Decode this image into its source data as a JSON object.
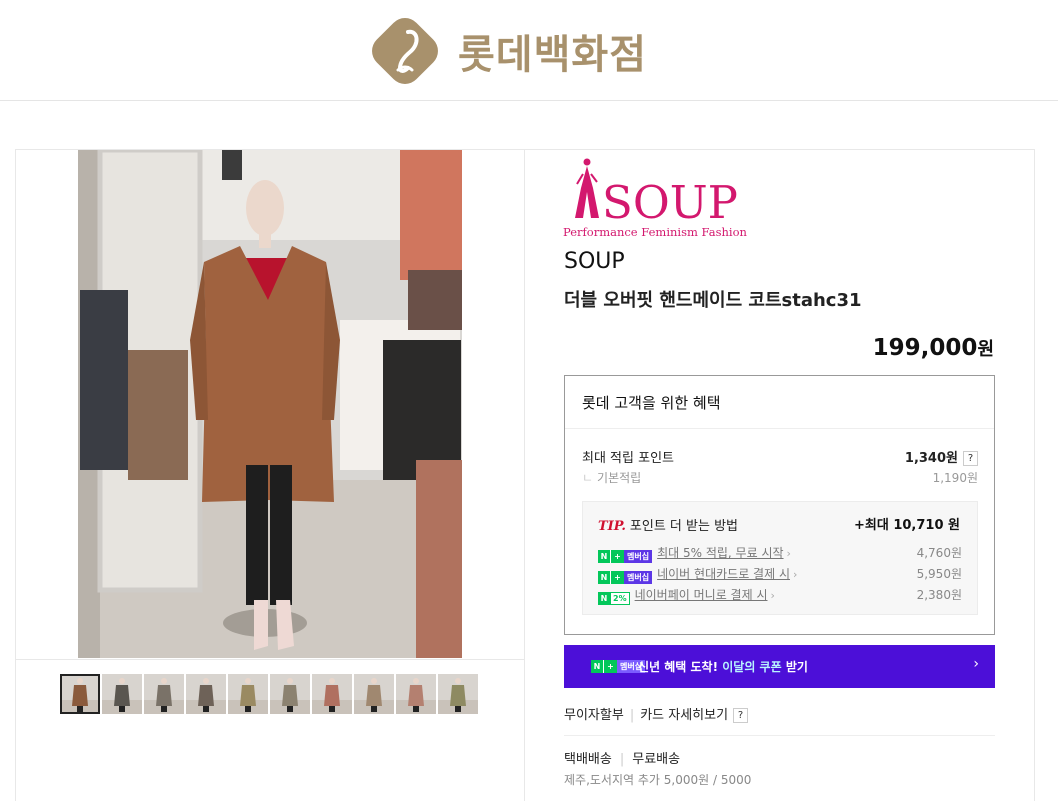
{
  "header": {
    "store_name": "롯데백화점",
    "logo_icon": "lotte-department-store-logo"
  },
  "gallery": {
    "main_image": "mannequin-camel-double-coat-in-store",
    "thumbnails": [
      {
        "icon": "thumb-1",
        "active": true
      },
      {
        "icon": "thumb-2"
      },
      {
        "icon": "thumb-3"
      },
      {
        "icon": "thumb-4"
      },
      {
        "icon": "thumb-5"
      },
      {
        "icon": "thumb-6"
      },
      {
        "icon": "thumb-7"
      },
      {
        "icon": "thumb-8"
      },
      {
        "icon": "thumb-9"
      },
      {
        "icon": "thumb-10"
      }
    ]
  },
  "product": {
    "brand_logo_text": "SOUP",
    "brand_logo_tagline": "Performance Feminism Fashion",
    "brand": "SOUP",
    "name": "더블 오버핏 핸드메이드 코트stahc31",
    "price": "199,000",
    "currency": "원"
  },
  "benefits": {
    "title": "롯데 고객을 위한 혜택",
    "max_points_label": "최대 적립 포인트",
    "max_points_value": "1,340원",
    "help_label": "?",
    "base_points_label": "기본적립",
    "base_points_value": "1,190원",
    "tip": {
      "tip_label": "TIP.",
      "heading": "포인트 더 받는 방법",
      "max_value": "+최대 10,710 원",
      "rows": [
        {
          "label": "최대 5% 적립, 무료 시작",
          "value": "4,760원",
          "badge": "membership"
        },
        {
          "label": "네이버 현대카드로 결제 시",
          "value": "5,950원",
          "badge": "membership"
        },
        {
          "label": "네이버페이 머니로 결제 시",
          "value": "2,380원",
          "badge": "2%"
        }
      ]
    }
  },
  "badges": {
    "n": "N",
    "plus": "+",
    "membership": "멤버십",
    "pct": "2%"
  },
  "promo": {
    "text_main": "신년 혜택 도착! ",
    "text_highlight": "이달의 쿠폰",
    "text_end": " 받기",
    "chevron": "›"
  },
  "installment": {
    "label": "무이자할부",
    "detail": "카드 자세히보기",
    "help": "?"
  },
  "delivery": {
    "type": "택배배송",
    "fee": "무료배송",
    "extra": "제주,도서지역 추가 5,000원 / 5000"
  },
  "colors": {
    "brand_gold": "#a8916c",
    "soup_pink": "#d3186e",
    "naver_green": "#03c75a",
    "promo_purple": "#4c0fd8",
    "tip_red": "#d0102f"
  }
}
